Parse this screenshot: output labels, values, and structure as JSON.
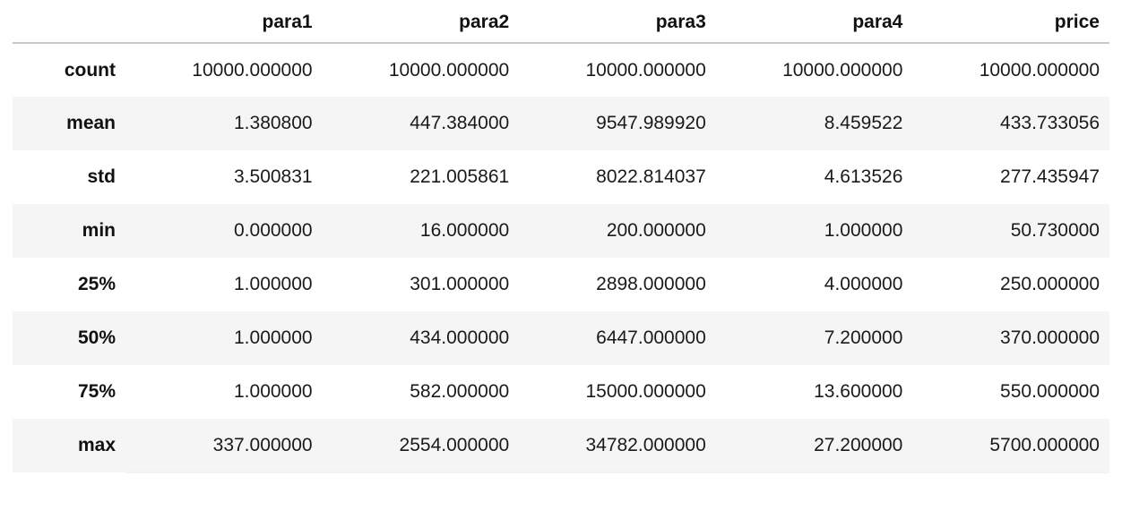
{
  "table": {
    "index_header": "",
    "columns": [
      "para1",
      "para2",
      "para3",
      "para4",
      "price"
    ],
    "index": [
      "count",
      "mean",
      "std",
      "min",
      "25%",
      "50%",
      "75%",
      "max"
    ],
    "rows": [
      {
        "label": "count",
        "cells": [
          "10000.000000",
          "10000.000000",
          "10000.000000",
          "10000.000000",
          "10000.000000"
        ]
      },
      {
        "label": "mean",
        "cells": [
          "1.380800",
          "447.384000",
          "9547.989920",
          "8.459522",
          "433.733056"
        ]
      },
      {
        "label": "std",
        "cells": [
          "3.500831",
          "221.005861",
          "8022.814037",
          "4.613526",
          "277.435947"
        ]
      },
      {
        "label": "min",
        "cells": [
          "0.000000",
          "16.000000",
          "200.000000",
          "1.000000",
          "50.730000"
        ]
      },
      {
        "label": "25%",
        "cells": [
          "1.000000",
          "301.000000",
          "2898.000000",
          "4.000000",
          "250.000000"
        ]
      },
      {
        "label": "50%",
        "cells": [
          "1.000000",
          "434.000000",
          "6447.000000",
          "7.200000",
          "370.000000"
        ]
      },
      {
        "label": "75%",
        "cells": [
          "1.000000",
          "582.000000",
          "15000.000000",
          "13.600000",
          "550.000000"
        ]
      },
      {
        "label": "max",
        "cells": [
          "337.000000",
          "2554.000000",
          "34782.000000",
          "27.200000",
          "5700.000000"
        ]
      }
    ]
  },
  "chart_data": {
    "type": "table",
    "title": "",
    "columns": [
      "para1",
      "para2",
      "para3",
      "para4",
      "price"
    ],
    "index": [
      "count",
      "mean",
      "std",
      "min",
      "25%",
      "50%",
      "75%",
      "max"
    ],
    "values": [
      [
        10000.0,
        10000.0,
        10000.0,
        10000.0,
        10000.0
      ],
      [
        1.3808,
        447.384,
        9547.98992,
        8.459522,
        433.733056
      ],
      [
        3.500831,
        221.005861,
        8022.814037,
        4.613526,
        277.435947
      ],
      [
        0.0,
        16.0,
        200.0,
        1.0,
        50.73
      ],
      [
        1.0,
        301.0,
        2898.0,
        4.0,
        250.0
      ],
      [
        1.0,
        434.0,
        6447.0,
        7.2,
        370.0
      ],
      [
        1.0,
        582.0,
        15000.0,
        13.6,
        550.0
      ],
      [
        337.0,
        2554.0,
        34782.0,
        27.2,
        5700.0
      ]
    ]
  },
  "style": {
    "stripe_color": "#f5f5f5",
    "background": "#ffffff",
    "text_color": "#1a1a1a",
    "header_rule_color": "#c8c8c8",
    "footer_rule_color": "#f2f2f2"
  }
}
